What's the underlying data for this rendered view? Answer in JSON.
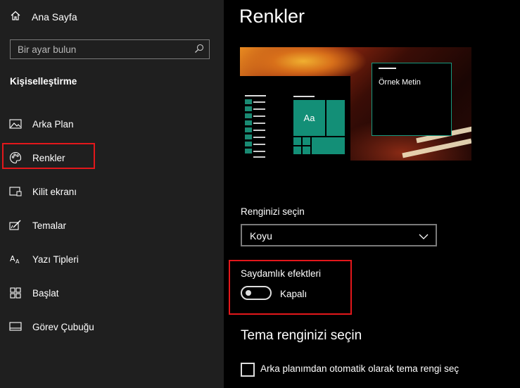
{
  "sidebar": {
    "home_label": "Ana Sayfa",
    "search_placeholder": "Bir ayar bulun",
    "section_title": "Kişiselleştirme",
    "items": [
      {
        "label": "Arka Plan",
        "icon": "image-icon"
      },
      {
        "label": "Renkler",
        "icon": "palette-icon",
        "selected": true
      },
      {
        "label": "Kilit ekranı",
        "icon": "lock-screen-icon"
      },
      {
        "label": "Temalar",
        "icon": "themes-icon"
      },
      {
        "label": "Yazı Tipleri",
        "icon": "fonts-icon"
      },
      {
        "label": "Başlat",
        "icon": "start-icon"
      },
      {
        "label": "Görev Çubuğu",
        "icon": "taskbar-icon"
      }
    ]
  },
  "main": {
    "title": "Renkler",
    "preview": {
      "tile_text": "Aa",
      "sample_text": "Örnek Metin"
    },
    "color_choice": {
      "label": "Renginizi seçin",
      "value": "Koyu"
    },
    "transparency": {
      "label": "Saydamlık efektleri",
      "state": "Kapalı",
      "on": false
    },
    "accent": {
      "heading": "Tema renginizi seçin",
      "checkbox_label": "Arka planımdan otomatik olarak tema rengi seç",
      "checked": false
    }
  },
  "colors": {
    "sidebar_bg": "#1f1f1f",
    "main_bg": "#000000",
    "accent": "#138f77",
    "highlight_border": "#e3171b"
  }
}
